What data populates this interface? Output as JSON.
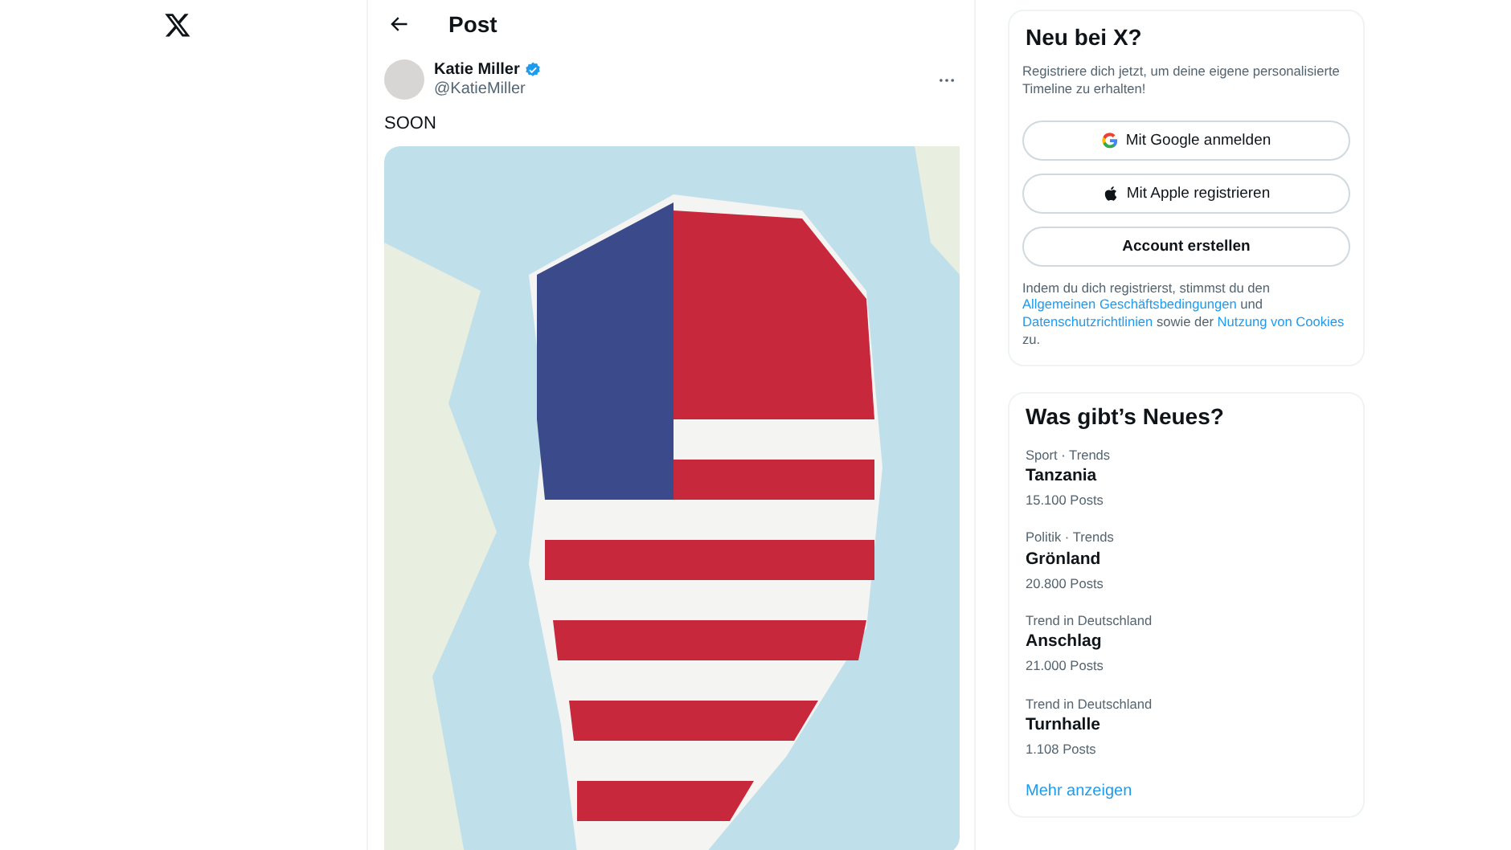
{
  "header": {
    "title": "Post"
  },
  "post": {
    "author": {
      "name": "Katie Miller",
      "handle": "@KatieMiller",
      "verified": true
    },
    "text": "SOON"
  },
  "signup": {
    "title": "Neu bei X?",
    "subtitle": "Registriere dich jetzt, um deine eigene personalisierte Timeline zu erhalten!",
    "buttons": [
      {
        "kind": "google",
        "label": "Mit Google anmelden"
      },
      {
        "kind": "apple",
        "label": "Mit Apple registrieren"
      },
      {
        "kind": "create",
        "label": "Account erstellen"
      }
    ],
    "legal": [
      {
        "text": "Indem du dich registrierst, stimmst du den ",
        "kind": "text"
      },
      {
        "text": "Allgemeinen Geschäftsbedingungen",
        "kind": "link"
      },
      {
        "text": " und ",
        "kind": "text"
      },
      {
        "text": "Datenschutzrichtlinien",
        "kind": "link"
      },
      {
        "text": " sowie der ",
        "kind": "text"
      },
      {
        "text": "Nutzung von Cookies",
        "kind": "link"
      },
      {
        "text": " zu.",
        "kind": "text"
      }
    ]
  },
  "trends": {
    "title": "Was gibt’s Neues?",
    "items": [
      {
        "context": "Sport · Trends",
        "name": "Tanzania",
        "count": "15.100 Posts"
      },
      {
        "context": "Politik · Trends",
        "name": "Grönland",
        "count": "20.800 Posts"
      },
      {
        "context": "Trend in Deutschland",
        "name": "Anschlag",
        "count": "21.000 Posts"
      },
      {
        "context": "Trend in Deutschland",
        "name": "Turnhalle",
        "count": "1.108 Posts"
      }
    ],
    "more": "Mehr anzeigen"
  }
}
